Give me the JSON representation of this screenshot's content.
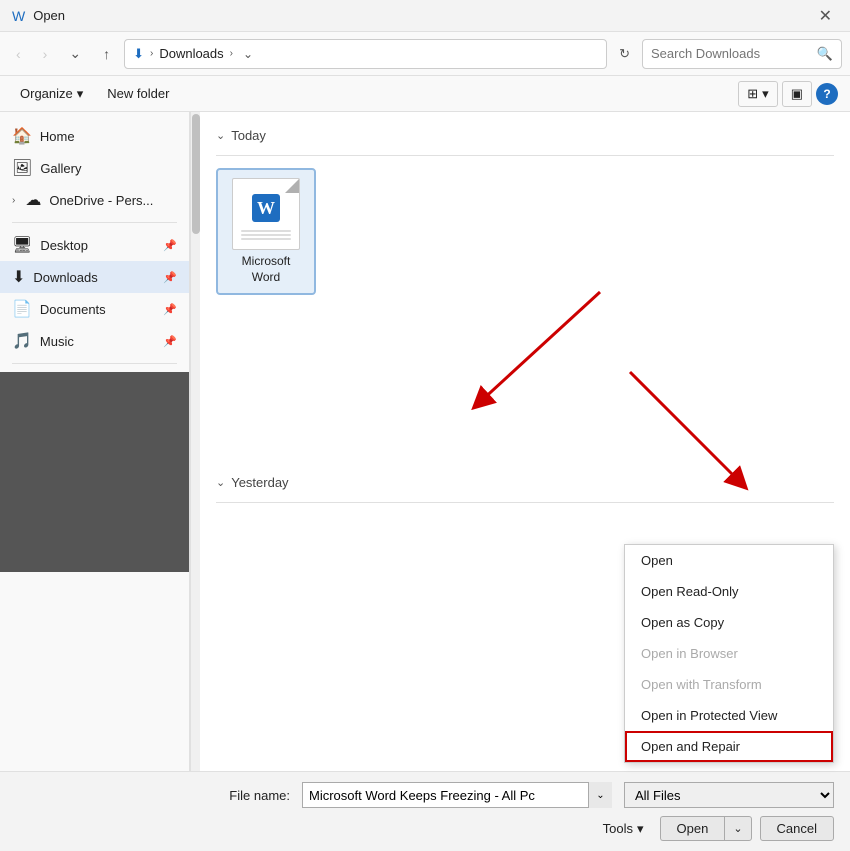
{
  "titleBar": {
    "icon": "W",
    "title": "Open",
    "closeLabel": "✕"
  },
  "navBar": {
    "back": "‹",
    "forward": "›",
    "downChevron": "∨",
    "up": "↑",
    "downloadIcon": "⬇",
    "pathParts": [
      "Downloads"
    ],
    "chevron": "›",
    "dropdownArrow": "∨",
    "refresh": "↻",
    "searchPlaceholder": "Search Downloads",
    "searchIcon": "🔍"
  },
  "toolbar": {
    "organize": "Organize",
    "organizeArrow": "▾",
    "newFolder": "New folder",
    "viewIcon": "⊞",
    "viewArrow": "▾",
    "paneIcon": "▣",
    "helpLabel": "?"
  },
  "sidebar": {
    "items": [
      {
        "icon": "🏠",
        "label": "Home",
        "active": false,
        "pin": false
      },
      {
        "icon": "🖼",
        "label": "Gallery",
        "active": false,
        "pin": false
      },
      {
        "icon": "☁",
        "label": "OneDrive - Pers...",
        "active": false,
        "pin": false,
        "expand": true
      },
      {
        "icon": "🖥",
        "label": "Desktop",
        "active": false,
        "pin": true
      },
      {
        "icon": "⬇",
        "label": "Downloads",
        "active": true,
        "pin": true
      },
      {
        "icon": "📄",
        "label": "Documents",
        "active": false,
        "pin": true
      },
      {
        "icon": "🎵",
        "label": "Music",
        "active": false,
        "pin": true
      }
    ]
  },
  "fileArea": {
    "todayLabel": "Today",
    "yesterdayLabel": "Yesterday",
    "files": [
      {
        "name": "Microsoft Word",
        "type": "docx",
        "selected": true
      }
    ]
  },
  "bottomBar": {
    "fileNameLabel": "File name:",
    "fileNameValue": "Microsoft Word Keeps Freezing - All Pc",
    "fileTypeValue": "All Files",
    "toolsLabel": "Tools",
    "toolsArrow": "▾",
    "openLabel": "Open",
    "openArrow": "▾",
    "cancelLabel": "Cancel"
  },
  "dropdownMenu": {
    "items": [
      {
        "label": "Open",
        "disabled": false,
        "highlighted": false
      },
      {
        "label": "Open Read-Only",
        "disabled": false,
        "highlighted": false
      },
      {
        "label": "Open as Copy",
        "disabled": false,
        "highlighted": false
      },
      {
        "label": "Open in Browser",
        "disabled": true,
        "highlighted": false
      },
      {
        "label": "Open with Transform",
        "disabled": true,
        "highlighted": false
      },
      {
        "label": "Open in Protected View",
        "disabled": false,
        "highlighted": false
      },
      {
        "label": "Open and Repair",
        "disabled": false,
        "highlighted": true
      }
    ]
  }
}
